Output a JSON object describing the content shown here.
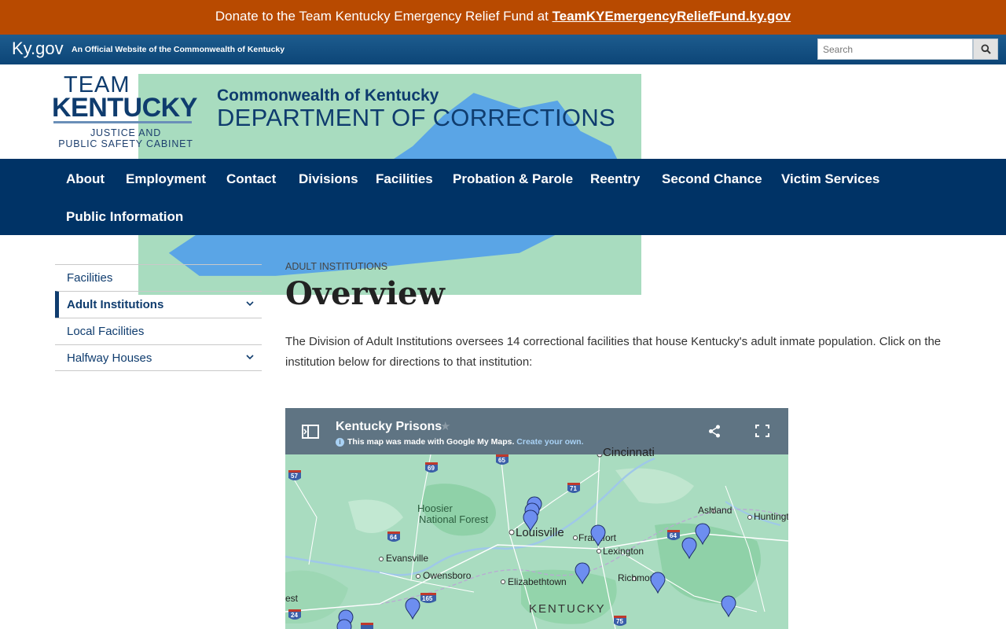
{
  "donate": {
    "prefix": "Donate to the Team Kentucky Emergency Relief Fund at ",
    "link": "TeamKYEmergencyReliefFund.ky.gov"
  },
  "kybar": {
    "logo": "Ky.gov",
    "official": "An Official Website of the Commonwealth of Kentucky",
    "search_placeholder": "Search"
  },
  "header": {
    "logo_team": "TEAM",
    "logo_kentucky": "KENTUCKY",
    "logo_cabinet_1": "JUSTICE AND",
    "logo_cabinet_2": "PUBLIC SAFETY CABINET",
    "commonwealth": "Commonwealth of Kentucky",
    "department": "DEPARTMENT OF CORRECTIONS"
  },
  "nav": {
    "items": [
      "About",
      "Employment",
      "Contact",
      "Divisions",
      "Facilities",
      "Probation & Parole",
      "Reentry",
      "Second Chance",
      "Victim Services",
      "Public Information"
    ]
  },
  "sidebar": {
    "items": [
      {
        "label": "Facilities"
      },
      {
        "label": "Adult Institutions"
      },
      {
        "label": "Local Facilities"
      },
      {
        "label": "Halfway Houses"
      }
    ]
  },
  "content": {
    "breadcrumb": "ADULT INSTITUTIONS",
    "title": "Overview",
    "description": "The Division of Adult Institutions oversees 14 correctional facilities that house Kentucky's adult inmate population. Click on the institution below for directions to that institution:"
  },
  "map": {
    "title": "Kentucky Prisons",
    "made_with": "This map was made with Google My Maps. ",
    "create": "Create your own.",
    "labels": {
      "cincinnati": "Cincinnati",
      "hoosier1": "Hoosier",
      "hoosier2": "National Forest",
      "louisville": "Louisville",
      "frankfort": "Frankfort",
      "lexington": "Lexington",
      "ashland": "Ashland",
      "huntington": "Huntingt",
      "evansville": "Evansville",
      "owensboro": "Owensboro",
      "elizabethtown": "Elizabethtown",
      "richmond": "Richmon",
      "kentucky": "KENTUCKY",
      "west": "est"
    },
    "highways": [
      "57",
      "69",
      "65",
      "71",
      "64",
      "64",
      "165",
      "24",
      "75"
    ]
  },
  "colors": {
    "banner": "#b84a00",
    "nav": "#003366",
    "brand": "#0f3c6e",
    "map_header": "#5f7483",
    "map_land": "#a8dcbf",
    "pin": "#6d8ef0"
  }
}
